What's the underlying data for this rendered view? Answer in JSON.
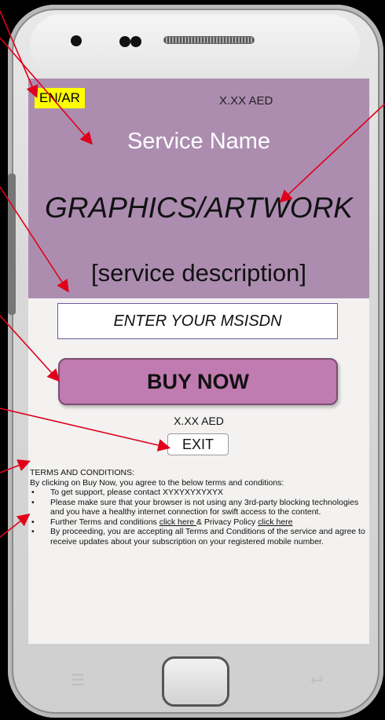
{
  "banner": {
    "lang_toggle": "EN/AR",
    "price": "X.XX AED",
    "service_name": "Service Name",
    "artwork": "GRAPHICS/ARTWORK",
    "description": "[service description]"
  },
  "form": {
    "msisdn_placeholder": "ENTER YOUR MSISDN",
    "buy_label": "BUY NOW",
    "price": "X.XX AED",
    "exit_label": "EXIT"
  },
  "terms": {
    "heading": "TERMS AND CONDITIONS:",
    "intro": "By clicking on Buy Now, you agree to the below terms and conditions:",
    "item1": "To get support, please contact XYXYXYXYXYX",
    "item2": "Please make sure that your browser is not using any 3rd-party blocking technologies and you have a healthy internet connection for swift access to the content.",
    "item3_prefix": "Further Terms and conditions ",
    "item3_link1": "click here ",
    "item3_mid": "& Privacy Policy ",
    "item3_link2": "click here",
    "item4": "By proceeding, you are accepting all Terms and Conditions of the service and agree to receive updates about your subscription on your registered mobile number."
  },
  "device": {
    "menu_icon": "menu-icon",
    "back_icon": "back-arrow-icon",
    "home_icon": "home-button"
  },
  "colors": {
    "banner": "#ac8db0",
    "buy_button": "#c07bb1",
    "lang_highlight": "#ffff00",
    "arrows": "#e0001b"
  }
}
